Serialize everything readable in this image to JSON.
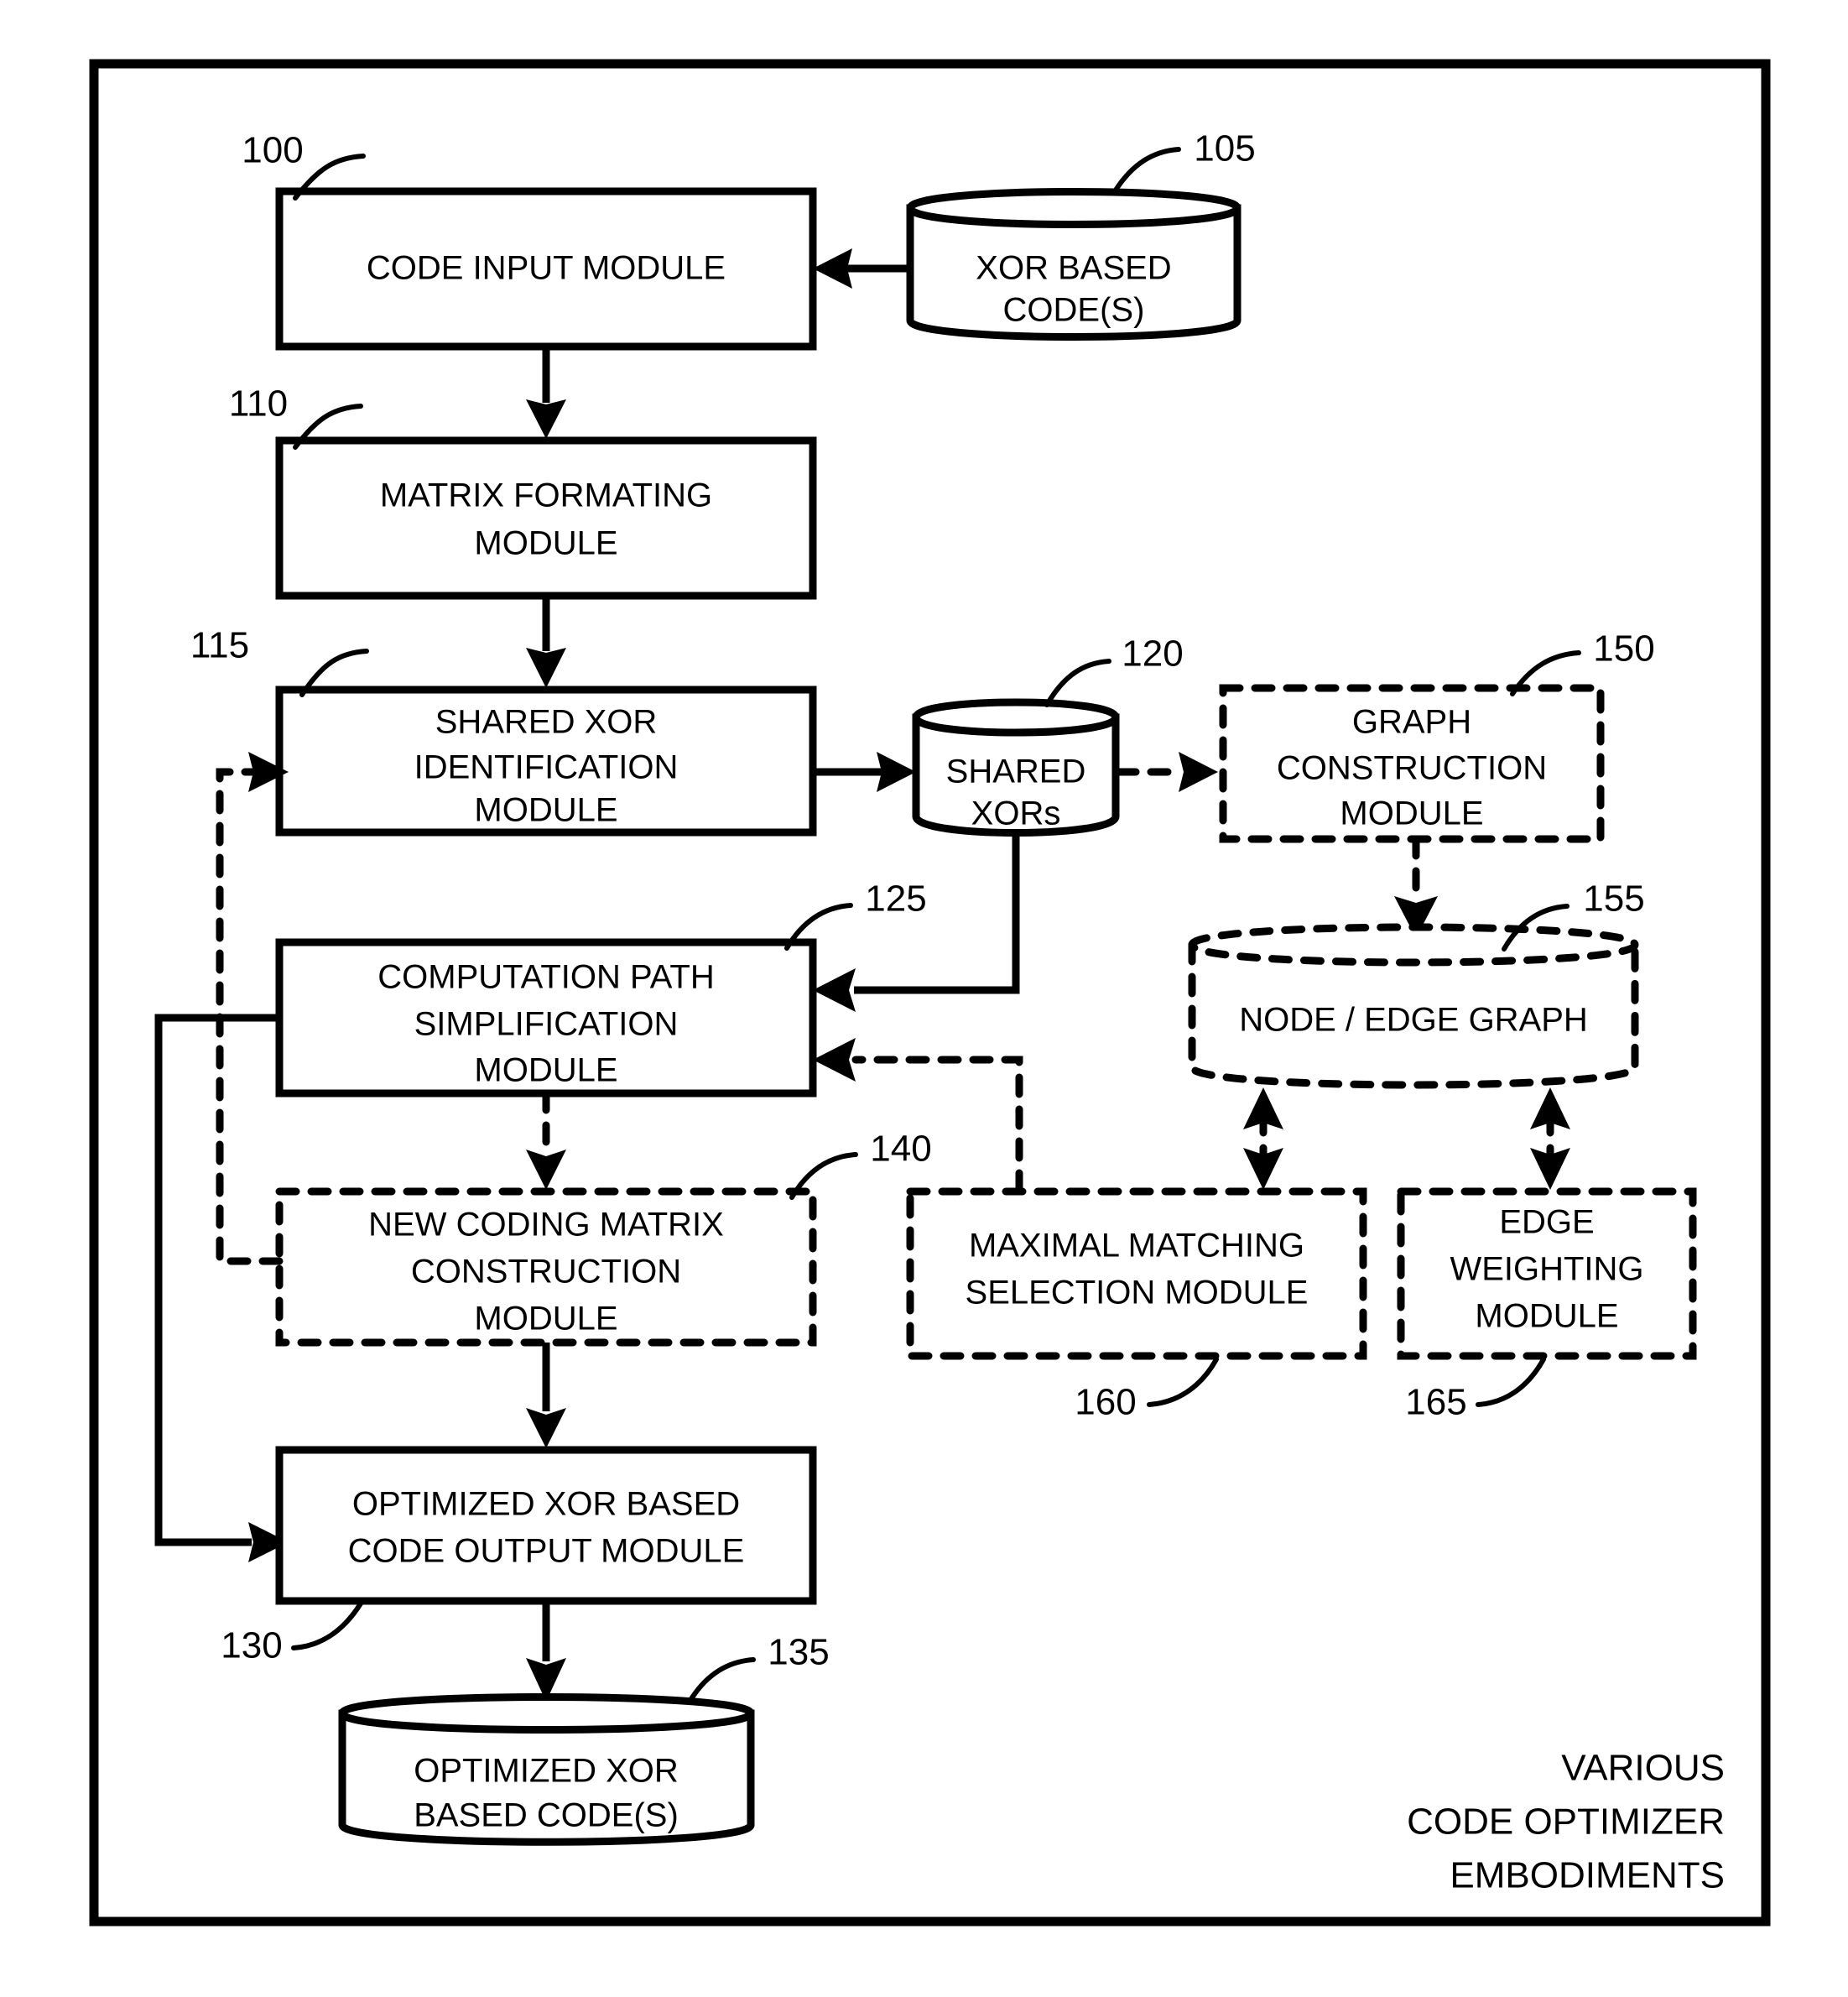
{
  "figure": {
    "caption_lines": [
      "VARIOUS",
      "CODE OPTIMIZER",
      "EMBODIMENTS"
    ]
  },
  "nodes": {
    "code_input": {
      "ref": "100",
      "lines": [
        "CODE INPUT MODULE"
      ],
      "shape": "rectangle",
      "style": "solid"
    },
    "xor_based_codes": {
      "ref": "105",
      "lines": [
        "XOR BASED",
        "CODE(S)"
      ],
      "shape": "cylinder",
      "style": "solid"
    },
    "matrix_formating": {
      "ref": "110",
      "lines": [
        "MATRIX FORMATING",
        "MODULE"
      ],
      "shape": "rectangle",
      "style": "solid"
    },
    "shared_xor_identification": {
      "ref": "115",
      "lines": [
        "SHARED XOR",
        "IDENTIFICATION",
        "MODULE"
      ],
      "shape": "rectangle",
      "style": "solid"
    },
    "shared_xors_store": {
      "ref": "120",
      "lines": [
        "SHARED",
        "XORs"
      ],
      "shape": "cylinder",
      "style": "solid"
    },
    "computation_path_simplification": {
      "ref": "125",
      "lines": [
        "COMPUTATION PATH",
        "SIMPLIFICATION",
        "MODULE"
      ],
      "shape": "rectangle",
      "style": "solid"
    },
    "optimized_output": {
      "ref": "130",
      "lines": [
        "OPTIMIZED XOR BASED",
        "CODE OUTPUT MODULE"
      ],
      "shape": "rectangle",
      "style": "solid"
    },
    "optimized_codes_store": {
      "ref": "135",
      "lines": [
        "OPTIMIZED XOR",
        "BASED CODE(S)"
      ],
      "shape": "cylinder",
      "style": "solid"
    },
    "new_coding_matrix_construction": {
      "ref": "140",
      "lines": [
        "NEW CODING MATRIX",
        "CONSTRUCTION",
        "MODULE"
      ],
      "shape": "rectangle",
      "style": "dashed"
    },
    "graph_construction": {
      "ref": "150",
      "lines": [
        "GRAPH",
        "CONSTRUCTION",
        "MODULE"
      ],
      "shape": "rectangle",
      "style": "dashed"
    },
    "node_edge_graph": {
      "ref": "155",
      "lines": [
        "NODE / EDGE GRAPH"
      ],
      "shape": "cylinder",
      "style": "dashed"
    },
    "maximal_matching_selection": {
      "ref": "160",
      "lines": [
        "MAXIMAL MATCHING",
        "SELECTION MODULE"
      ],
      "shape": "rectangle",
      "style": "dashed"
    },
    "edge_weighting": {
      "ref": "165",
      "lines": [
        "EDGE",
        "WEIGHTING",
        "MODULE"
      ],
      "shape": "rectangle",
      "style": "dashed"
    }
  },
  "colors": {
    "ink": "#000000",
    "paper": "#ffffff"
  }
}
